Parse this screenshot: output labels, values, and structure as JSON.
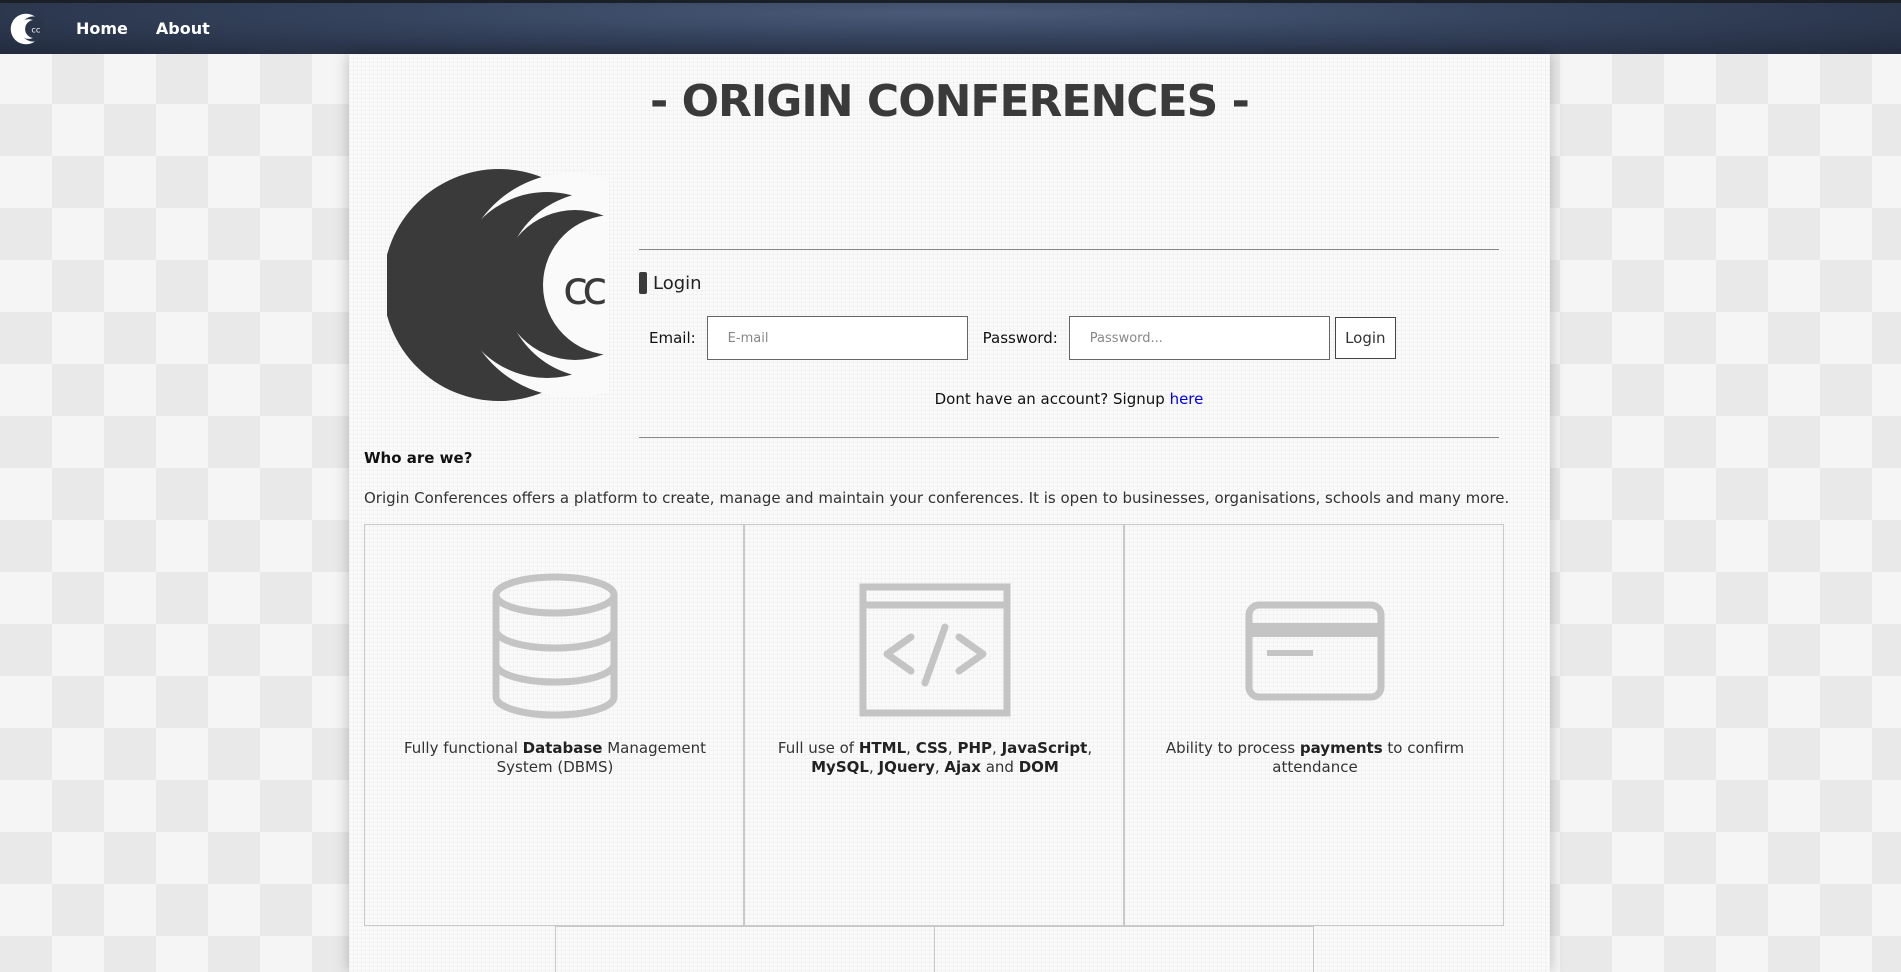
{
  "nav": {
    "home_label": "Home",
    "about_label": "About"
  },
  "page": {
    "title": "- ORIGIN CONFERENCES -"
  },
  "login": {
    "heading": "Login",
    "email_label": "Email:",
    "email_placeholder": "E-mail",
    "password_label": "Password:",
    "password_placeholder": "Password...",
    "button_label": "Login",
    "signup_prefix": "Dont have an account? Signup ",
    "signup_link": "here"
  },
  "about": {
    "heading": "Who are we?",
    "text": "Origin Conferences offers a platform to create, manage and maintain your conferences. It is open to businesses, organisations, schools and many more."
  },
  "features": [
    {
      "icon": "database-icon",
      "t1": "Fully functional ",
      "b1": "Database",
      "t2": " Management System (DBMS)"
    },
    {
      "icon": "code-window-icon",
      "t1": "Full use of ",
      "b1": "HTML",
      "s1": ", ",
      "b2": "CSS",
      "s2": ", ",
      "b3": "PHP",
      "s3": ", ",
      "b4": "JavaScript",
      "s4": ", ",
      "b5": "MySQL",
      "s5": ", ",
      "b6": "JQuery",
      "s6": ", ",
      "b7": "Ajax",
      "s7": " and ",
      "b8": "DOM"
    },
    {
      "icon": "credit-card-icon",
      "t1": "Ability to process ",
      "b1": "payments",
      "t2": " to confirm attendance"
    }
  ],
  "colors": {
    "nav_bg": "#34425c",
    "panel_bg": "#fafafa",
    "logo": "#3a3a3a",
    "icon_grey": "#c4c4c4",
    "link": "#0000ee"
  }
}
